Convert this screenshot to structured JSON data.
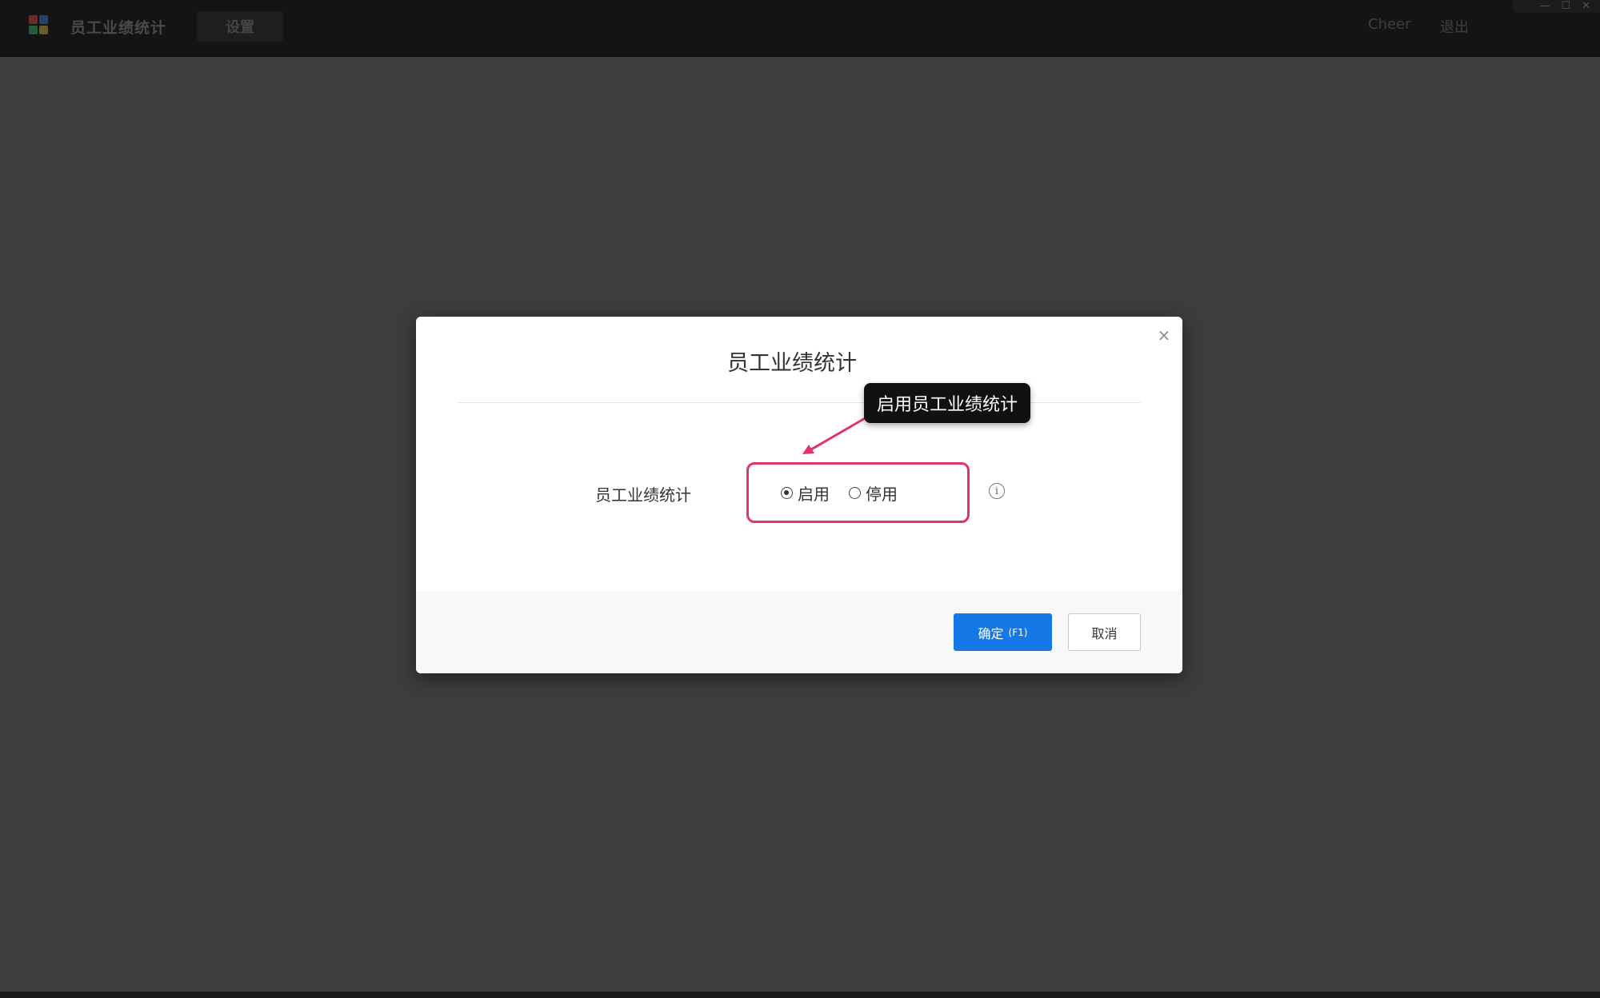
{
  "topbar": {
    "app_title": "员工业绩统计",
    "settings_tab": "设置",
    "user_name": "Cheer",
    "logout": "退出",
    "window_minimize": "—",
    "window_maximize": "☐",
    "window_close": "✕"
  },
  "dialog": {
    "title": "员工业绩统计",
    "close_icon": "×",
    "field_label": "员工业绩统计",
    "options": [
      {
        "label": "启用",
        "checked": true
      },
      {
        "label": "停用",
        "checked": false
      }
    ],
    "info_icon": "i",
    "tooltip": "启用员工业绩统计",
    "ok_label": "确定",
    "ok_shortcut": "(F1)",
    "cancel_label": "取消"
  },
  "colors": {
    "primary": "#1677e6",
    "highlight": "#e0336f",
    "overlay": "#3d3d3d"
  }
}
